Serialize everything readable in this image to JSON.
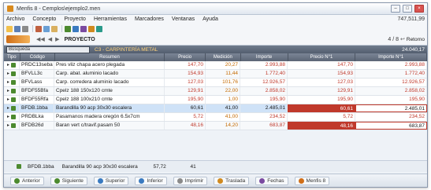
{
  "window": {
    "title": "Menfis 8 - Cemplos\\ejemplo2.men"
  },
  "menu": [
    "Archivo",
    "Concepto",
    "Proyecto",
    "Herramientas",
    "Marcadores",
    "Ventanas",
    "Ayuda"
  ],
  "menu_right": "747,511,99",
  "toolbar_icons": [
    "open-icon",
    "save-icon",
    "print-icon",
    "cut-icon",
    "copy-icon",
    "paste-icon",
    "table-icon",
    "chart-icon",
    "tree-icon",
    "calc-icon",
    "info-icon"
  ],
  "project": {
    "label": "PROYECTO",
    "pagecount": "4 / 8",
    "return_label": "Retorno"
  },
  "searchbar": {
    "value": "Búsqueda",
    "path": "C3 - CARPINTERÍA METAL",
    "total": "24.040,17"
  },
  "columns": [
    "Tipo",
    "Código",
    "Resumen",
    "Precio",
    "Medición",
    "Importe",
    "Precio N°1",
    "Importe N°1"
  ],
  "rows": [
    {
      "code": "PRDC13seba",
      "summary": "Pres vliz chapa acero plegada",
      "price": "147,70",
      "med": "20,27",
      "imp": "2.993,88",
      "p1": "147,70",
      "i1": "2.993,88"
    },
    {
      "code": "BFVLL3c",
      "summary": "Carp. abat. aluminio lacado",
      "price": "154,93",
      "med": "11,44",
      "imp": "1.772,40",
      "p1": "154,93",
      "i1": "1.772,40"
    },
    {
      "code": "BFVLass",
      "summary": "Carp. corredera aluminio lacado",
      "price": "127,03",
      "med": "101,76",
      "imp": "12.926,57",
      "p1": "127,03",
      "i1": "12.926,57"
    },
    {
      "code": "BFDF55Bfa",
      "summary": "Cpelz 188 150x120 cmte",
      "price": "129,91",
      "med": "22,00",
      "imp": "2.858,02",
      "p1": "129,91",
      "i1": "2.858,02"
    },
    {
      "code": "BFDF55Rfa",
      "summary": "Cpelz 188 100x210 cmte",
      "price": "195,90",
      "med": "1,00",
      "imp": "195,90",
      "p1": "195,90",
      "i1": "195,90"
    },
    {
      "code": "BFDB.1bba",
      "summary": "Barandilla 90 acp 30x30 escalera",
      "price": "60,61",
      "med": "41,00",
      "imp": "2.485,01",
      "p1": "60,61",
      "i1": "2.485,01"
    },
    {
      "code": "PRDBLka",
      "summary": "Pasamanos madera oregón 6.5x7cm",
      "price": "5,72",
      "med": "41,00",
      "imp": "234,52",
      "p1": "5,72",
      "i1": "234,52"
    },
    {
      "code": "BFDB26d",
      "summary": "Baran vert c/travif.pasam 50",
      "price": "48,16",
      "med": "14,20",
      "imp": "683,87",
      "p1": "48,16",
      "i1": "683,87"
    }
  ],
  "detail": {
    "code": "BFDB.1bba",
    "summary": "Barandilla 90 acp 30x30 escalera",
    "price": "57,72",
    "med": "41"
  },
  "bottom_buttons": [
    "Anterior",
    "Siguiente",
    "Superior",
    "Inferior",
    "Imprimir",
    "Traslada",
    "Fechas",
    "Menfis 8"
  ]
}
